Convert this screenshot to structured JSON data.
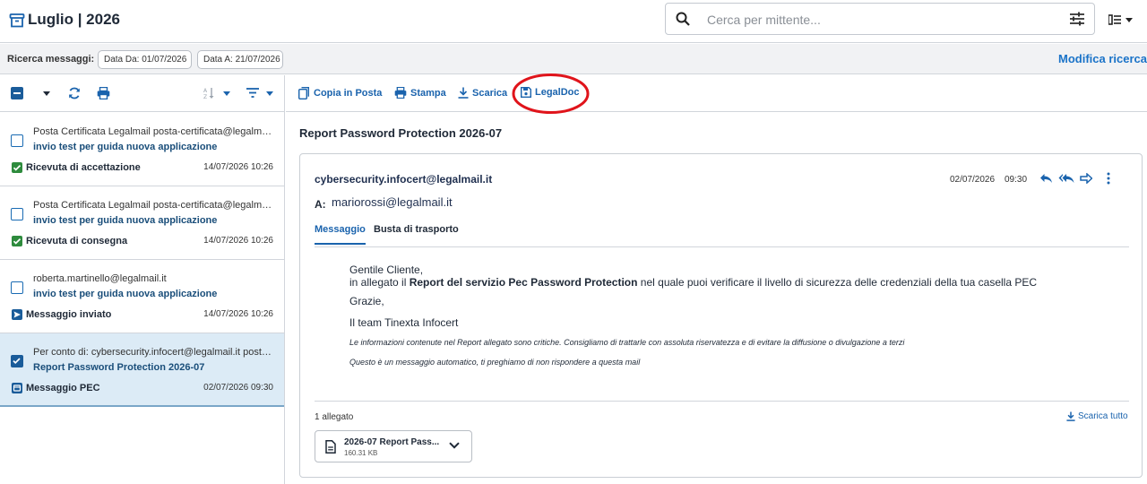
{
  "header": {
    "title": "Luglio | 2026",
    "search_placeholder": "Cerca per mittente...",
    "search_value": "",
    "icons": {
      "logo": "archive-box-icon",
      "search": "search-icon",
      "filter": "tune-sliders-icon",
      "view": "view-list-icon"
    }
  },
  "criteria": {
    "label": "Ricerca messaggi:",
    "date_from": "Data Da: 01/07/2026",
    "date_to": "Data A: 21/07/2026",
    "modify_label": "Modifica ricerca"
  },
  "actions": {
    "copy": "Copia in Posta",
    "print": "Stampa",
    "download": "Scarica",
    "legaldoc": "LegalDoc"
  },
  "messages": [
    {
      "sender": "Posta Certificata Legalmail posta-certificata@legalmail.it",
      "subject": "invio test per guida nuova applicazione",
      "status": "Ricevuta di accettazione",
      "status_icon": "check-badge-icon",
      "status_color": "#2e8b3d",
      "date": "14/07/2026 10:26",
      "selected": false
    },
    {
      "sender": "Posta Certificata Legalmail posta-certificata@legalmail.it",
      "subject": "invio test per guida nuova applicazione",
      "status": "Ricevuta di consegna",
      "status_icon": "check-badge-icon",
      "status_color": "#2e8b3d",
      "date": "14/07/2026 10:26",
      "selected": false
    },
    {
      "sender": "roberta.martinello@legalmail.it",
      "subject": "invio test per guida nuova applicazione",
      "status": "Messaggio inviato",
      "status_icon": "send-badge-icon",
      "status_color": "#1a5c9a",
      "date": "14/07/2026 10:26",
      "selected": false
    },
    {
      "sender": "Per conto di: cybersecurity.infocert@legalmail.it postacertificata",
      "subject": "Report Password Protection 2026-07",
      "status": "Messaggio PEC",
      "status_icon": "mail-badge-icon",
      "status_color": "#1a5c9a",
      "date": "02/07/2026 09:30",
      "selected": true
    }
  ],
  "detail": {
    "subject": "Report Password Protection 2026-07",
    "from": "cybersecurity.infocert@legalmail.it",
    "date": "02/07/2026",
    "time": "09:30",
    "to_label": "A:",
    "to": "mariorossi@legalmail.it",
    "tabs": {
      "message": "Messaggio",
      "transport": "Busta di trasporto"
    },
    "body": {
      "greeting": "Gentile Cliente,",
      "line1_pre": "in allegato il ",
      "line1_bold": "Report del servizio Pec Password Protection",
      "line1_post": " nel quale puoi verificare il livello di sicurezza delle credenziali della tua casella PEC",
      "thanks": "Grazie,",
      "signature": "Il team Tinexta Infocert",
      "note1": "Le informazioni contenute nel Report allegato sono critiche. Consigliamo di trattarle con assoluta riservatezza e di evitare la diffusione o divulgazione a terzi",
      "note2": "Questo è un messaggio automatico, ti preghiamo di non rispondere a questa mail"
    },
    "attachments": {
      "count_label": "1 allegato",
      "download_all": "Scarica tutto",
      "items": [
        {
          "name": "2026-07 Report Pass...",
          "size": "160.31 KB"
        }
      ]
    }
  },
  "colors": {
    "accent": "#1a63ad",
    "highlight_ring": "#e0141b",
    "selected_bg": "#dcebf6"
  }
}
